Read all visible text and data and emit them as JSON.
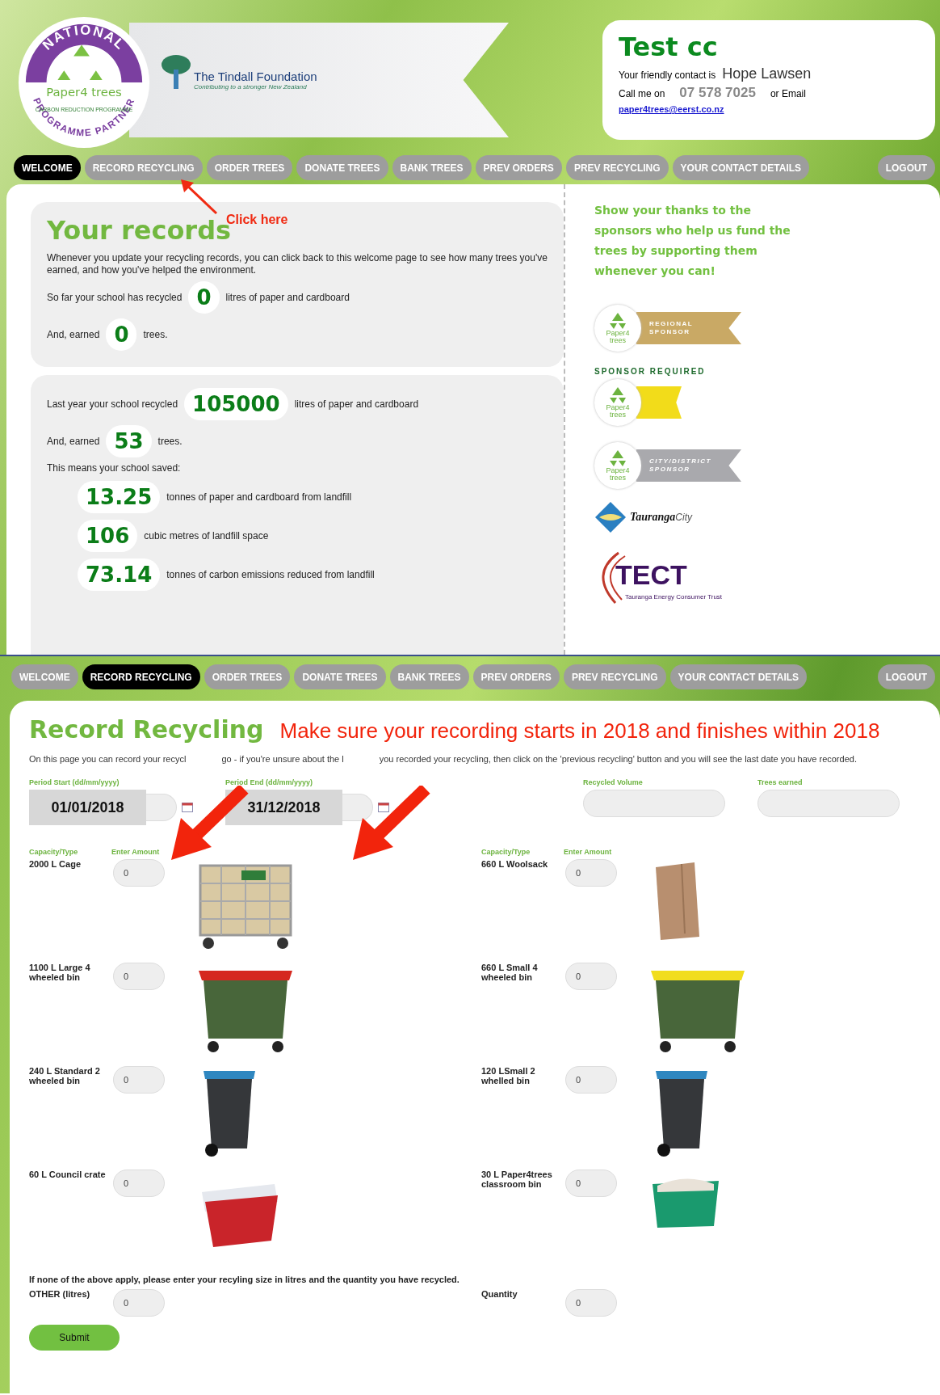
{
  "top_screen": {
    "logo": {
      "arc_top": "NATIONAL",
      "brand": "Paper4 trees",
      "programme": "CARBON REDUCTION PROGRAMME",
      "arc_bottom": "PROGRAMME PARTNER"
    },
    "foundation": {
      "name": "The Tindall Foundation",
      "tagline": "Contributing to a stronger New Zealand"
    },
    "contact": {
      "school": "Test cc",
      "intro": "Your friendly contact is",
      "name": "Hope Lawsen",
      "call_label": "Call me on",
      "phone": "07 578 7025",
      "email_label": "or Email",
      "email": "paper4trees@eerst.co.nz"
    },
    "nav": {
      "tabs": [
        {
          "label": "WELCOME",
          "selected": true
        },
        {
          "label": "RECORD RECYCLING",
          "selected": false
        },
        {
          "label": "ORDER TREES",
          "selected": false
        },
        {
          "label": "DONATE TREES",
          "selected": false
        },
        {
          "label": "BANK TREES",
          "selected": false
        },
        {
          "label": "PREV ORDERS",
          "selected": false
        },
        {
          "label": "PREV RECYCLING",
          "selected": false
        },
        {
          "label": "YOUR CONTACT DETAILS",
          "selected": false
        }
      ],
      "logout": "LOGOUT"
    },
    "annotation": "Click here",
    "records": {
      "title": "Your records",
      "intro": "Whenever you update your recycling records, you can click back to this welcome page to see how many trees you've earned, and how you've helped the environment.",
      "stats": [
        {
          "before": "So far your school has recycled",
          "value": "0",
          "after": "litres of paper and cardboard"
        },
        {
          "before": "And, earned",
          "value": "0",
          "after": "trees."
        }
      ]
    },
    "last_year": {
      "stats": [
        {
          "before": "Last year your school recycled",
          "value": "105000",
          "after": "litres of paper and cardboard"
        },
        {
          "before": "And, earned",
          "value": "53",
          "after": "trees."
        }
      ],
      "saved_label": "This means your school saved:",
      "savings": [
        {
          "value": "13.25",
          "text": "tonnes of paper and cardboard from landfill"
        },
        {
          "value": "106",
          "text": "cubic metres of landfill space"
        },
        {
          "value": "73.14",
          "text": "tonnes of carbon emissions reduced from landfill"
        }
      ]
    },
    "sponsors": {
      "thanks": "Show your thanks to the sponsors who help us fund the trees by supporting them whenever you can!",
      "badges": [
        {
          "kind": "regional",
          "brand": "Paper4 trees",
          "line1": "REGIONAL",
          "line2": "SPONSOR"
        },
        {
          "kind": "required",
          "brand": "Paper4 trees",
          "line1": "SPONSOR REQUIRED"
        },
        {
          "kind": "city",
          "brand": "Paper4 trees",
          "line1": "CITY/DISTRICT",
          "line2": "SPONSOR"
        }
      ],
      "logos": [
        {
          "kind": "tauranga",
          "name": "Tauranga",
          "suffix": "City"
        },
        {
          "kind": "tect",
          "name": "TECT",
          "subtitle": "Tauranga Energy Consumer Trust"
        }
      ]
    }
  },
  "bottom_screen": {
    "nav": {
      "tabs": [
        {
          "label": "WELCOME",
          "selected": false
        },
        {
          "label": "RECORD RECYCLING",
          "selected": true
        },
        {
          "label": "ORDER TREES",
          "selected": false
        },
        {
          "label": "DONATE TREES",
          "selected": false
        },
        {
          "label": "BANK TREES",
          "selected": false
        },
        {
          "label": "PREV ORDERS",
          "selected": false
        },
        {
          "label": "PREV RECYCLING",
          "selected": false
        },
        {
          "label": "YOUR CONTACT DETAILS",
          "selected": false
        }
      ],
      "logout": "LOGOUT"
    },
    "title": "Record Recycling",
    "notice": "Make sure your recording starts in 2018 and finishes within 2018",
    "description_parts": [
      "On this page you can record your recycl",
      "go - if you're unsure about the l",
      "you recorded your recycling, then click on the 'previous recycling' button and you will see the last date you have recorded."
    ],
    "period_start": {
      "label": "Period Start (dd/mm/yyyy)",
      "value": "01/01/2018"
    },
    "period_end": {
      "label": "Period End (dd/mm/yyyy)",
      "value": "31/12/2018"
    },
    "recycled_volume": {
      "label": "Recycled Volume"
    },
    "trees_earned": {
      "label": "Trees earned"
    },
    "column_headers": [
      {
        "type": "Capacity/Type",
        "amount": "Enter Amount"
      },
      {
        "type": "Capacity/Type",
        "amount": "Enter Amount"
      }
    ],
    "containers": [
      {
        "kind": "cage",
        "name": "2000 L Cage",
        "value": "0"
      },
      {
        "kind": "sack",
        "name": "660 L Woolsack",
        "value": "0"
      },
      {
        "kind": "large-bin",
        "name": "1100 L Large 4 wheeled bin",
        "value": "0"
      },
      {
        "kind": "medium-bin",
        "name": "660 L Small 4 wheeled bin",
        "value": "0"
      },
      {
        "kind": "wheelie-large",
        "name": "240 L Standard 2 wheeled bin",
        "value": "0"
      },
      {
        "kind": "wheelie-small",
        "name": "120 LSmall 2 whelled bin",
        "value": "0"
      },
      {
        "kind": "crate",
        "name": "60 L Council crate",
        "value": "0"
      },
      {
        "kind": "tub",
        "name": "30 L Paper4trees classroom bin",
        "value": "0"
      }
    ],
    "other_note": "If none of the above apply, please enter your recyling size in litres and the quantity you have recycled.",
    "other": {
      "label": "OTHER (litres)",
      "value": "0"
    },
    "quantity": {
      "label": "Quantity",
      "value": "0"
    },
    "submit": "Submit"
  }
}
